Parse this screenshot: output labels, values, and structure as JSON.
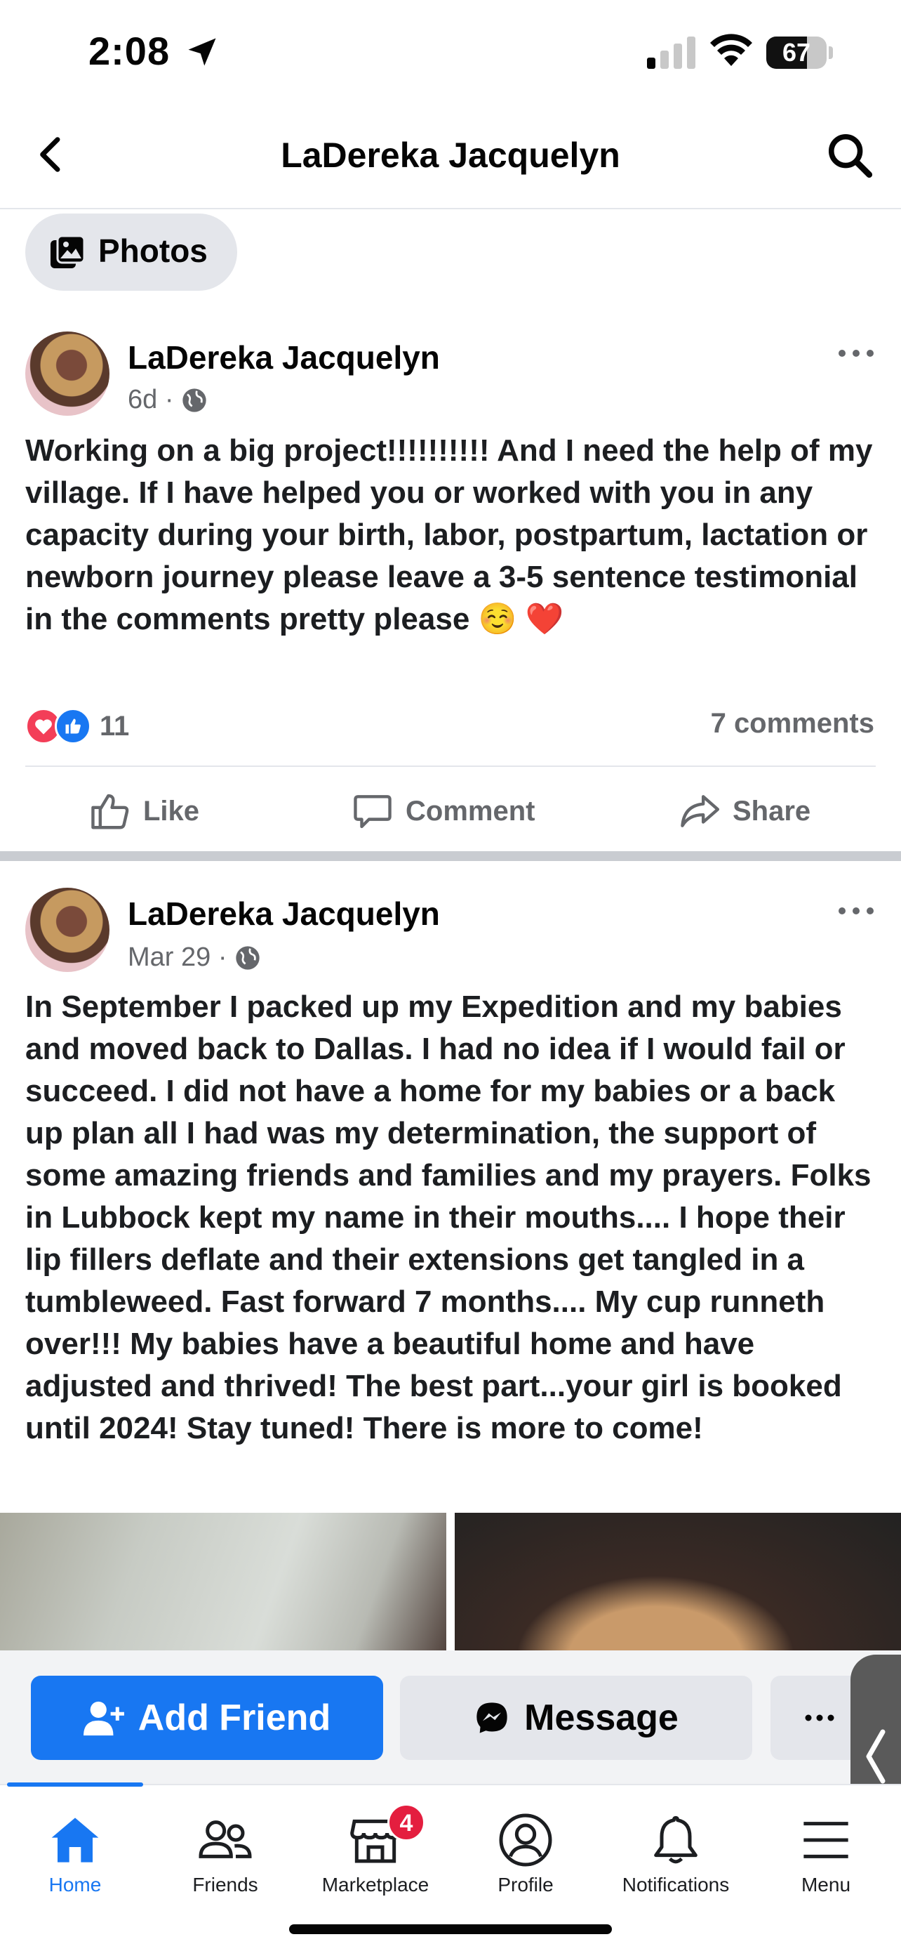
{
  "status_bar": {
    "time": "2:08",
    "battery": "67",
    "battery_level_percent": 67,
    "icons": [
      "location-arrow-icon",
      "cellular-signal-icon",
      "wifi-icon",
      "battery-icon"
    ]
  },
  "header": {
    "title": "LaDereka Jacquelyn",
    "icons": [
      "back-chevron-icon",
      "search-icon"
    ]
  },
  "photos_chip": {
    "label": "Photos",
    "icon": "photos-icon"
  },
  "posts": [
    {
      "author": "LaDereka Jacquelyn",
      "time": "6d ·",
      "audience_icon": "globe-icon",
      "text": "Working on a big project!!!!!!!!!! And I need the help of my village. If I have helped you or worked with you in any capacity during your birth, labor, postpartum, lactation or newborn journey please leave a 3-5 sentence testimonial in the comments pretty please ☺️ ❤️",
      "reactions": {
        "icons": [
          "love-reaction-icon",
          "like-reaction-icon"
        ],
        "count": "11"
      },
      "comments": "7 comments",
      "actions": [
        {
          "label": "Like",
          "icon": "thumbs-up-icon"
        },
        {
          "label": "Comment",
          "icon": "comment-bubble-icon"
        },
        {
          "label": "Share",
          "icon": "share-arrow-icon"
        }
      ]
    },
    {
      "author": "LaDereka Jacquelyn",
      "time": "Mar 29 ·",
      "audience_icon": "globe-icon",
      "text": "In September I packed up my Expedition and my babies and moved back to Dallas. I had no idea if I would fail or succeed. I did not have a home for my babies or a back up plan all I had was my determination, the support of some amazing friends and families and my prayers. Folks in Lubbock kept my name in their mouths.... I hope their lip fillers deflate and their extensions get tangled in a tumbleweed. Fast forward 7 months.... My cup runneth over!!! My babies have a beautiful home and  have adjusted and thrived! The best part...your girl is booked until 2024! Stay tuned! There is more to come!"
    }
  ],
  "profile_actions": {
    "add_friend": "Add Friend",
    "message": "Message",
    "icons": [
      "add-person-icon",
      "messenger-icon",
      "more-dots-icon"
    ]
  },
  "tab_bar": {
    "tabs": [
      {
        "label": "Home",
        "icon": "home-icon",
        "active": true
      },
      {
        "label": "Friends",
        "icon": "friends-icon"
      },
      {
        "label": "Marketplace",
        "icon": "marketplace-icon",
        "badge": "4"
      },
      {
        "label": "Profile",
        "icon": "profile-icon"
      },
      {
        "label": "Notifications",
        "icon": "bell-icon"
      },
      {
        "label": "Menu",
        "icon": "menu-icon"
      }
    ]
  },
  "colors": {
    "accent": "#1877f2",
    "badge": "#e41e3f",
    "secondary_text": "#65676b",
    "chip_bg": "#e4e6eb"
  }
}
